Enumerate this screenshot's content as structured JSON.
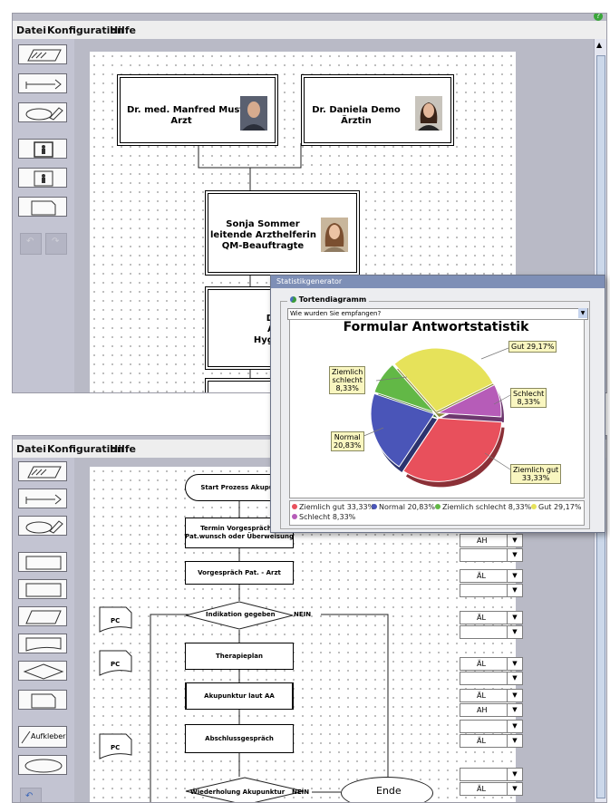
{
  "menu": [
    "Datei",
    "Konfiguration",
    "Hilfe"
  ],
  "palette_top": [
    "select-tool",
    "connector-tool",
    "comment-tool",
    "person-card",
    "person-small",
    "note-shape",
    "undo",
    "redo"
  ],
  "palette_bottom": [
    "select-tool",
    "connector-tool",
    "comment-tool",
    "rectangle-shape",
    "rectangle-shape-2",
    "parallelogram-shape",
    "document-shape",
    "diamond-shape",
    "note-shape",
    "sticker-tool",
    "ellipse-shape",
    "undo"
  ],
  "sticker_label": "Aufkleber",
  "org_chart": {
    "doctor1": {
      "line1": "Dr. med. Manfred Muster",
      "line2": "Arzt"
    },
    "doctor2": {
      "line1": "Dr. Daniela Demo",
      "line2": "Ärztin"
    },
    "assistant": {
      "line1": "Sonja Sommer",
      "line2": "leitende Arzthelferin",
      "line3": "QM-Beauftragte"
    },
    "hygiene": {
      "line1": "Doris Dr",
      "line2": "Arzthelf",
      "line3": "Hygienebe"
    }
  },
  "flowchart": {
    "start": "Start Prozess Akupunkt",
    "termin_1": "Termin Vorgespräch a",
    "termin_2": "Pat.wunsch oder Überweisung",
    "vorgespraech": "Vorgespräch Pat. - Arzt",
    "indikation": "Indikation gegeben",
    "nein1": "NEIN",
    "therapieplan": "Therapieplan",
    "akupunktur": "Akupunktur laut AA",
    "abschluss": "Abschlussgespräch",
    "wiederholung": "Wiederholung Akupunktur",
    "nein2": "NEIN",
    "ende": "Ende",
    "pc": "PC"
  },
  "role_selects": [
    "AH",
    "",
    "ÄL",
    "",
    "ÄL",
    "",
    "ÄL",
    "",
    "ÄL",
    "AH",
    "",
    "ÄL",
    "",
    "ÄL"
  ],
  "dialog": {
    "title": "Statistikgenerator",
    "group_label": "Tortendiagramm",
    "question": "Wie wurden Sie empfangen?"
  },
  "chart_data": {
    "type": "pie",
    "title": "Formular Antwortstatistik",
    "slices": [
      {
        "name": "Ziemlich gut",
        "value": 33.33,
        "label": "33,33%",
        "color": "#e8505c"
      },
      {
        "name": "Normal",
        "value": 20.83,
        "label": "20,83%",
        "color": "#4a55b8"
      },
      {
        "name": "Ziemlich schlecht",
        "value": 8.33,
        "label": "8,33%",
        "color": "#62b846"
      },
      {
        "name": "Gut",
        "value": 29.17,
        "label": "29,17%",
        "color": "#e6e25a"
      },
      {
        "name": "Schlecht",
        "value": 8.33,
        "label": "8,33%",
        "color": "#b65cb8"
      }
    ],
    "callouts": {
      "gut": "Gut 29,17%",
      "schlecht_1": "Schlecht",
      "schlecht_2": "8,33%",
      "ziemlich_gut_1": "Ziemlich gut",
      "ziemlich_gut_2": "33,33%",
      "normal_1": "Normal",
      "normal_2": "20,83%",
      "zs_1": "Ziemlich",
      "zs_2": "schlecht",
      "zs_3": "8,33%"
    },
    "legend": [
      "Ziemlich gut 33,33%",
      "Normal 20,83%",
      "Ziemlich schlecht 8,33%",
      "Gut 29,17%",
      "Schlecht 8,33%"
    ],
    "legend_position": "bottom"
  },
  "colors": {
    "palette_bg": "#c3c4d2",
    "dialog_title": "#7e8fb6",
    "help_icon": "#3aa63a"
  }
}
